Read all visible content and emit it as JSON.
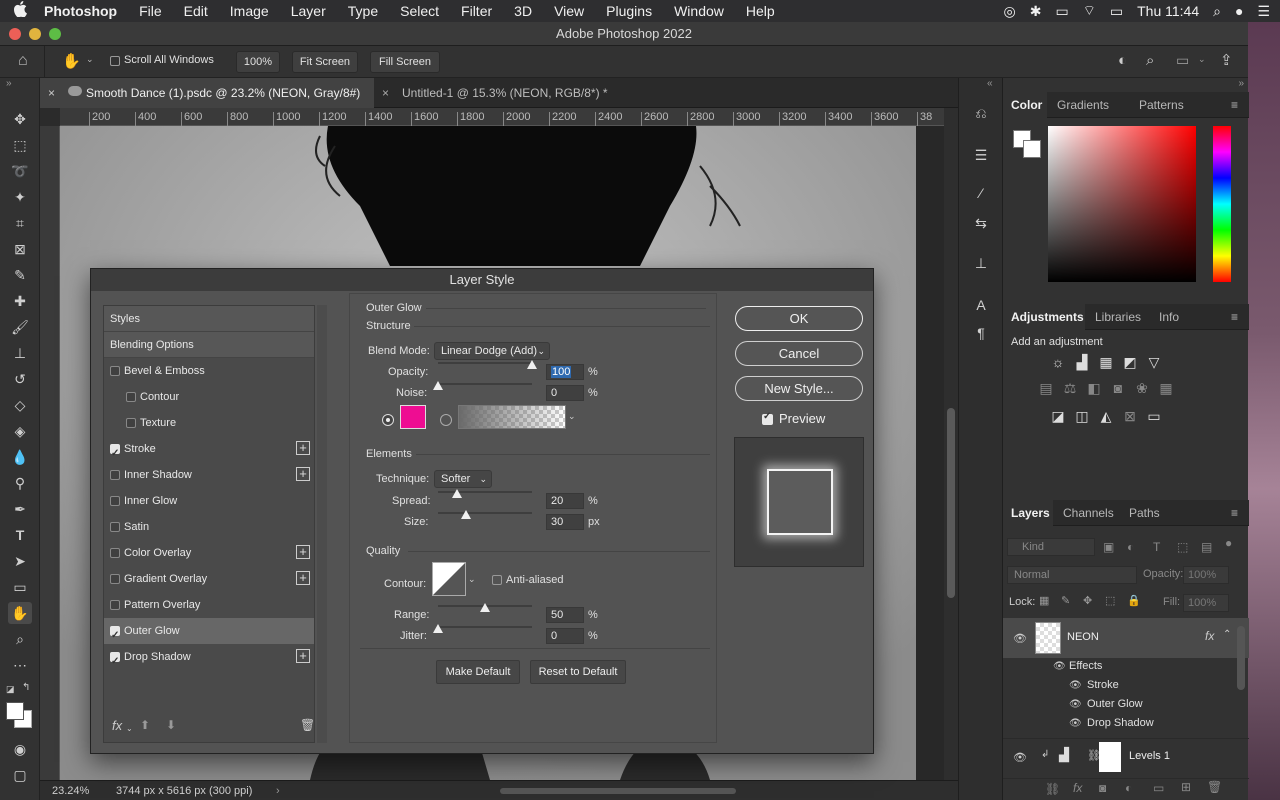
{
  "menubar": {
    "apple": "",
    "app": "Photoshop",
    "items": [
      "File",
      "Edit",
      "Image",
      "Layer",
      "Type",
      "Select",
      "Filter",
      "3D",
      "View",
      "Plugins",
      "Window",
      "Help"
    ],
    "clock": "Thu 11:44"
  },
  "window": {
    "title": "Adobe Photoshop 2022"
  },
  "options": {
    "scroll_all_label": "Scroll All Windows",
    "zoom": "100%",
    "fit_screen": "Fit Screen",
    "fill_screen": "Fill Screen"
  },
  "tabs": [
    {
      "label": "Smooth Dance (1).psdc @ 23.2% (NEON, Gray/8#)"
    },
    {
      "label": "Untitled-1 @ 15.3% (NEON, RGB/8*) *"
    }
  ],
  "ruler": {
    "ticks": [
      "200",
      "400",
      "600",
      "800",
      "1000",
      "1200",
      "1400",
      "1600",
      "1800",
      "2000",
      "2200",
      "2400",
      "2600",
      "2800",
      "3000",
      "3200",
      "3400",
      "3600",
      "38"
    ]
  },
  "status": {
    "zoom": "23.24%",
    "doc_info": "3744 px x 5616 px (300 ppi)"
  },
  "dialog": {
    "title": "Layer Style",
    "styles_header": "Styles",
    "blending_options": "Blending Options",
    "items": [
      {
        "label": "Bevel & Emboss",
        "checked": false,
        "plus": false
      },
      {
        "label": "Contour",
        "checked": false,
        "plus": false
      },
      {
        "label": "Texture",
        "checked": false,
        "plus": false
      },
      {
        "label": "Stroke",
        "checked": true,
        "plus": true
      },
      {
        "label": "Inner Shadow",
        "checked": false,
        "plus": true
      },
      {
        "label": "Inner Glow",
        "checked": false,
        "plus": false
      },
      {
        "label": "Satin",
        "checked": false,
        "plus": false
      },
      {
        "label": "Color Overlay",
        "checked": false,
        "plus": true
      },
      {
        "label": "Gradient Overlay",
        "checked": false,
        "plus": true
      },
      {
        "label": "Pattern Overlay",
        "checked": false,
        "plus": false
      },
      {
        "label": "Outer Glow",
        "checked": true,
        "plus": false
      },
      {
        "label": "Drop Shadow",
        "checked": true,
        "plus": true
      }
    ],
    "panel_title": "Outer Glow",
    "structure": {
      "title": "Structure",
      "blend_mode_label": "Blend Mode:",
      "blend_mode": "Linear Dodge (Add)",
      "opacity_label": "Opacity:",
      "opacity": "100",
      "opacity_value": 100,
      "noise_label": "Noise:",
      "noise": "0",
      "noise_value": 0,
      "pct": "%",
      "glow_color": "#ee0d92"
    },
    "elements": {
      "title": "Elements",
      "technique_label": "Technique:",
      "technique": "Softer",
      "spread_label": "Spread:",
      "spread": "20",
      "spread_value": 20,
      "size_label": "Size:",
      "size": "30",
      "size_value": 30,
      "size_unit": "px"
    },
    "quality": {
      "title": "Quality",
      "contour_label": "Contour:",
      "anti_aliased": "Anti-aliased",
      "range_label": "Range:",
      "range": "50",
      "range_value": 50,
      "jitter_label": "Jitter:",
      "jitter": "0",
      "jitter_value": 0
    },
    "make_default": "Make Default",
    "reset_default": "Reset to Default",
    "ok": "OK",
    "cancel": "Cancel",
    "new_style": "New Style...",
    "preview": "Preview"
  },
  "color_panel": {
    "tabs": [
      "Color",
      "Gradients",
      "Patterns"
    ]
  },
  "adjust_panel": {
    "tabs": [
      "Adjustments",
      "Libraries",
      "Info"
    ],
    "subtitle": "Add an adjustment"
  },
  "layers_panel": {
    "tabs": [
      "Layers",
      "Channels",
      "Paths"
    ],
    "kind": "Kind",
    "blend": "Normal",
    "opacity_label": "Opacity:",
    "opacity": "100%",
    "lock_label": "Lock:",
    "fill_label": "Fill:",
    "fill": "100%",
    "layers": [
      {
        "name": "NEON",
        "effects_label": "Effects",
        "effects": [
          "Stroke",
          "Outer Glow",
          "Drop Shadow"
        ]
      },
      {
        "name": "Levels 1"
      }
    ]
  }
}
